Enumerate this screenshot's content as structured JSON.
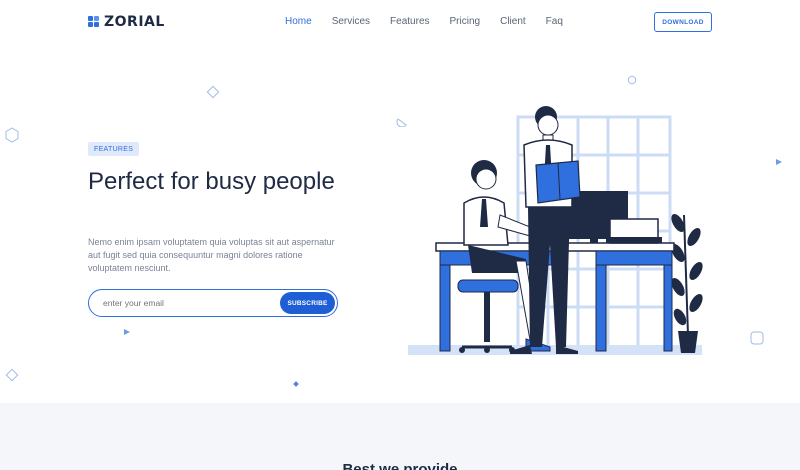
{
  "brand": {
    "name": "ZORIAL",
    "color": "#2f6fde"
  },
  "nav": {
    "items": [
      {
        "label": "Home",
        "active": true
      },
      {
        "label": "Services",
        "active": false
      },
      {
        "label": "Features",
        "active": false
      },
      {
        "label": "Pricing",
        "active": false
      },
      {
        "label": "Client",
        "active": false
      },
      {
        "label": "Faq",
        "active": false
      }
    ]
  },
  "header": {
    "download_label": "DOWNLOAD"
  },
  "hero": {
    "badge": "FEATURES",
    "title": "Perfect for busy people",
    "description": "Nemo enim ipsam voluptatem quia voluptas sit aut aspernatur aut fugit sed quia consequuntur magni dolores ratione voluptatem nesciunt.",
    "subscribe": {
      "placeholder": "enter your email",
      "button_label": "SUBSCRIBE"
    }
  },
  "section2": {
    "title": "Best we provide"
  },
  "colors": {
    "accent": "#2f6fde",
    "button": "#1e5fd6",
    "section_bg": "#f4f6f9",
    "text_dark": "#1f2a44"
  }
}
